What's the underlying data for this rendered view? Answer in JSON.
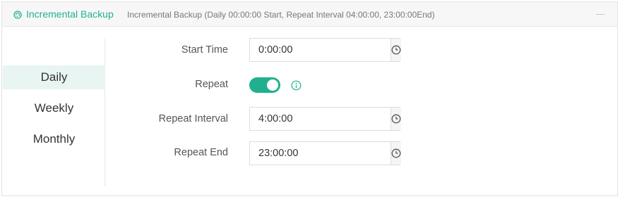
{
  "header": {
    "title": "Incremental Backup",
    "description": "Incremental Backup (Daily 00:00:00 Start, Repeat Interval 04:00:00, 23:00:00End)",
    "icon": "refresh-icon",
    "accent_color": "#20b08f"
  },
  "tabs": [
    {
      "label": "Daily",
      "active": true
    },
    {
      "label": "Weekly",
      "active": false
    },
    {
      "label": "Monthly",
      "active": false
    }
  ],
  "form": {
    "start_time": {
      "label": "Start Time",
      "value": "0:00:00",
      "icon": "clock-icon"
    },
    "repeat": {
      "label": "Repeat",
      "enabled": true,
      "icon": "info-icon"
    },
    "repeat_interval": {
      "label": "Repeat Interval",
      "value": "4:00:00",
      "icon": "clock-icon"
    },
    "repeat_end": {
      "label": "Repeat End",
      "value": "23:00:00",
      "icon": "clock-icon"
    }
  }
}
